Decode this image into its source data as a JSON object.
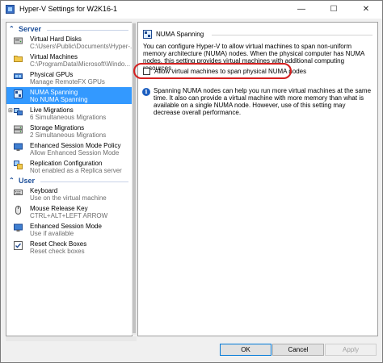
{
  "window": {
    "title": "Hyper-V Settings for W2K16-1",
    "minimize_glyph": "—",
    "maximize_glyph": "☐",
    "close_glyph": "✕"
  },
  "sidebar": {
    "sections": [
      {
        "label": "Server",
        "items": [
          {
            "name": "Virtual Hard Disks",
            "sub": "C:\\Users\\Public\\Documents\\Hyper-...",
            "icon": "hard-disk-icon"
          },
          {
            "name": "Virtual Machines",
            "sub": "C:\\ProgramData\\Microsoft\\Windo...",
            "icon": "folder-icon"
          },
          {
            "name": "Physical GPUs",
            "sub": "Manage RemoteFX GPUs",
            "icon": "gpu-icon"
          },
          {
            "name": "NUMA Spanning",
            "sub": "No NUMA Spanning",
            "icon": "numa-icon",
            "selected": true
          },
          {
            "name": "Live Migrations",
            "sub": "6 Simultaneous Migrations",
            "icon": "migration-icon",
            "expander": "⊞"
          },
          {
            "name": "Storage Migrations",
            "sub": "2 Simultaneous Migrations",
            "icon": "storage-icon"
          },
          {
            "name": "Enhanced Session Mode Policy",
            "sub": "Allow Enhanced Session Mode",
            "icon": "session-icon"
          },
          {
            "name": "Replication Configuration",
            "sub": "Not enabled as a Replica server",
            "icon": "replication-icon"
          }
        ]
      },
      {
        "label": "User",
        "items": [
          {
            "name": "Keyboard",
            "sub": "Use on the virtual machine",
            "icon": "keyboard-icon"
          },
          {
            "name": "Mouse Release Key",
            "sub": "CTRL+ALT+LEFT ARROW",
            "icon": "mouse-icon"
          },
          {
            "name": "Enhanced Session Mode",
            "sub": "Use if available",
            "icon": "monitor-icon"
          },
          {
            "name": "Reset Check Boxes",
            "sub": "Reset check boxes",
            "icon": "check-icon"
          }
        ]
      }
    ]
  },
  "main": {
    "header": "NUMA Spanning",
    "para1": "You can configure Hyper-V to allow virtual machines to span non-uniform memory architecture (NUMA) nodes. When the physical computer has NUMA nodes, this setting provides virtual machines with additional computing resources.",
    "checkbox_label": "Allow virtual machines to span physical NUMA nodes",
    "checkbox_checked": false,
    "para2": "Spanning NUMA nodes can help you run more virtual machines at the same time. It also can provide a virtual machine with more memory than what is available on a single NUMA node. However, use of this setting may decrease overall performance."
  },
  "buttons": {
    "ok": "OK",
    "cancel": "Cancel",
    "apply": "Apply"
  },
  "colors": {
    "selection": "#3399ff",
    "section": "#1d4f9a",
    "annotation": "#d42020"
  }
}
